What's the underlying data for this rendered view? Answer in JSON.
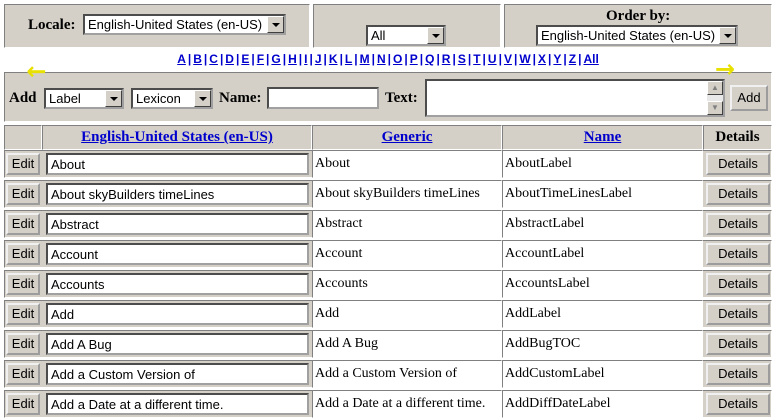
{
  "top": {
    "locale_label": "Locale:",
    "locale_value": "English-United States (en-US)",
    "filter_value": "All",
    "orderby_label": "Order by:",
    "orderby_value": "English-United States (en-US)"
  },
  "alphabet": [
    "A",
    "B",
    "C",
    "D",
    "E",
    "F",
    "G",
    "H",
    "I",
    "J",
    "K",
    "L",
    "M",
    "N",
    "O",
    "P",
    "Q",
    "R",
    "S",
    "T",
    "U",
    "V",
    "W",
    "X",
    "Y",
    "Z",
    "All"
  ],
  "add_bar": {
    "add_label": "Add",
    "type_value": "Label",
    "source_value": "Lexicon",
    "name_label": "Name:",
    "name_value": "",
    "text_label": "Text:",
    "text_value": "",
    "add_button": "Add"
  },
  "table": {
    "headers": [
      "English-United States (en-US)",
      "Generic",
      "Name",
      "Details"
    ],
    "rows": [
      {
        "edit": "Edit",
        "locale": "About",
        "generic": "About",
        "name": "AboutLabel",
        "details": "Details"
      },
      {
        "edit": "Edit",
        "locale": "About skyBuilders timeLines",
        "generic": "About skyBuilders timeLines",
        "name": "AboutTimeLinesLabel",
        "details": "Details"
      },
      {
        "edit": "Edit",
        "locale": "Abstract",
        "generic": "Abstract",
        "name": "AbstractLabel",
        "details": "Details"
      },
      {
        "edit": "Edit",
        "locale": "Account",
        "generic": "Account",
        "name": "AccountLabel",
        "details": "Details"
      },
      {
        "edit": "Edit",
        "locale": "Accounts",
        "generic": "Accounts",
        "name": "AccountsLabel",
        "details": "Details"
      },
      {
        "edit": "Edit",
        "locale": "Add",
        "generic": "Add",
        "name": "AddLabel",
        "details": "Details"
      },
      {
        "edit": "Edit",
        "locale": "Add A Bug",
        "generic": "Add A Bug",
        "name": "AddBugTOC",
        "details": "Details"
      },
      {
        "edit": "Edit",
        "locale": "Add a Custom Version of",
        "generic": "Add a Custom Version of",
        "name": "AddCustomLabel",
        "details": "Details"
      },
      {
        "edit": "Edit",
        "locale": "Add a Date at a different time.",
        "generic": "Add a Date at a different time.",
        "name": "AddDiffDateLabel",
        "details": "Details"
      }
    ]
  },
  "colors": {
    "panel": "#d4d0c8",
    "link": "#0000cc",
    "arrow": "#e8e000"
  }
}
